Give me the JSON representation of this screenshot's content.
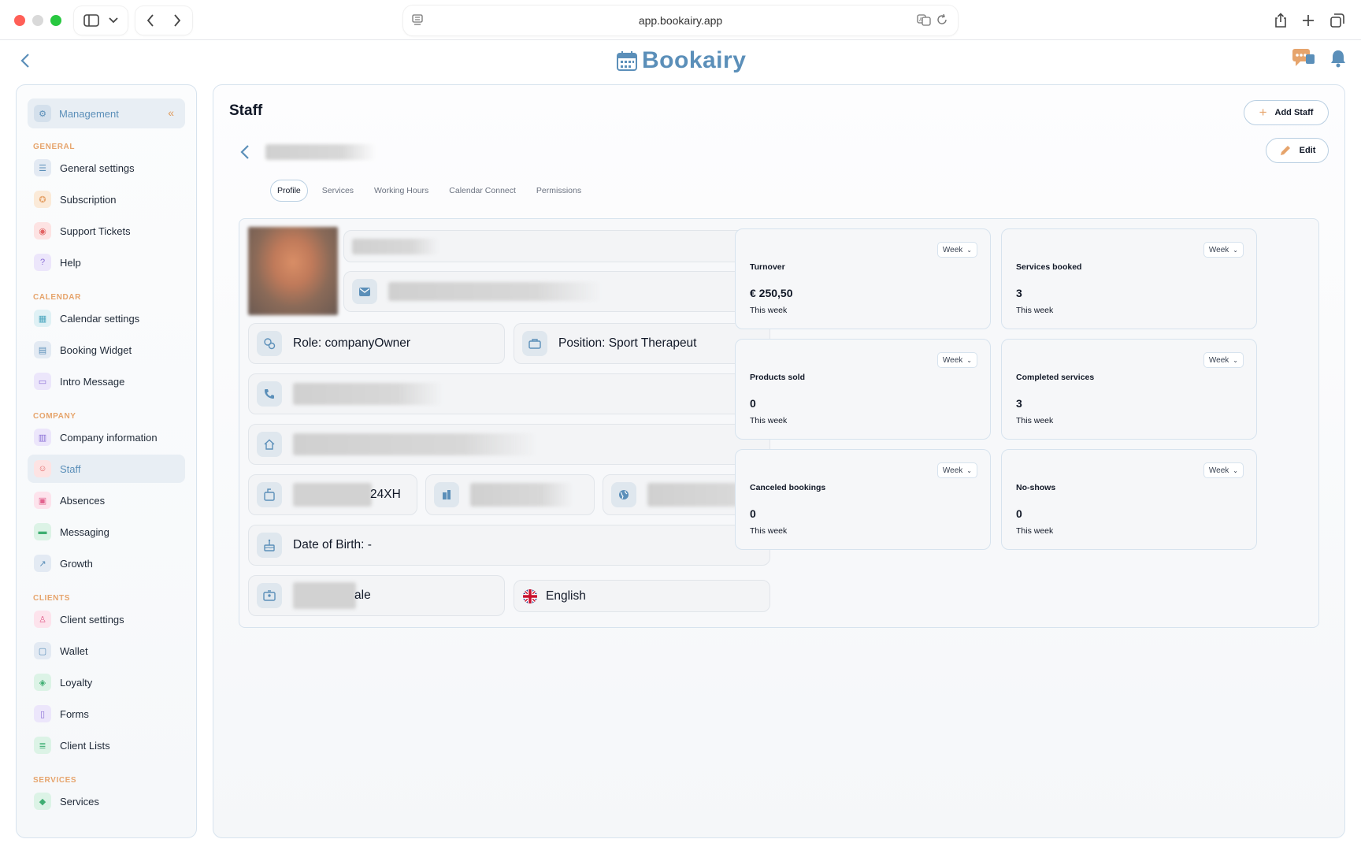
{
  "browser": {
    "url": "app.bookairy.app"
  },
  "brand": {
    "name": "Bookairy",
    "color": "#5b8fb9"
  },
  "sidebar": {
    "top_item": "Management",
    "sections": [
      {
        "title": "GENERAL",
        "items": [
          "General settings",
          "Subscription",
          "Support Tickets",
          "Help"
        ]
      },
      {
        "title": "CALENDAR",
        "items": [
          "Calendar settings",
          "Booking Widget",
          "Intro Message"
        ]
      },
      {
        "title": "COMPANY",
        "items": [
          "Company information",
          "Staff",
          "Absences",
          "Messaging",
          "Growth"
        ]
      },
      {
        "title": "CLIENTS",
        "items": [
          "Client settings",
          "Wallet",
          "Loyalty",
          "Forms",
          "Client Lists"
        ]
      },
      {
        "title": "SERVICES",
        "items": [
          "Services"
        ]
      }
    ],
    "active_item": "Staff"
  },
  "main": {
    "title": "Staff",
    "add_staff_label": "Add Staff",
    "edit_label": "Edit",
    "tabs": [
      "Profile",
      "Services",
      "Working Hours",
      "Calendar Connect",
      "Permissions"
    ],
    "active_tab": "Profile"
  },
  "profile": {
    "role": "Role: companyOwner",
    "position": "Position: Sport Therapeut",
    "postal_partial": "24XH",
    "date_of_birth": "Date of Birth: -",
    "gender_partial": "ale",
    "language": "English"
  },
  "stats": [
    {
      "label": "Turnover",
      "value": "€ 250,50",
      "period": "This week",
      "range": "Week"
    },
    {
      "label": "Services booked",
      "value": "3",
      "period": "This week",
      "range": "Week"
    },
    {
      "label": "Products sold",
      "value": "0",
      "period": "This week",
      "range": "Week"
    },
    {
      "label": "Completed services",
      "value": "3",
      "period": "This week",
      "range": "Week"
    },
    {
      "label": "Canceled bookings",
      "value": "0",
      "period": "This week",
      "range": "Week"
    },
    {
      "label": "No-shows",
      "value": "0",
      "period": "This week",
      "range": "Week"
    }
  ]
}
